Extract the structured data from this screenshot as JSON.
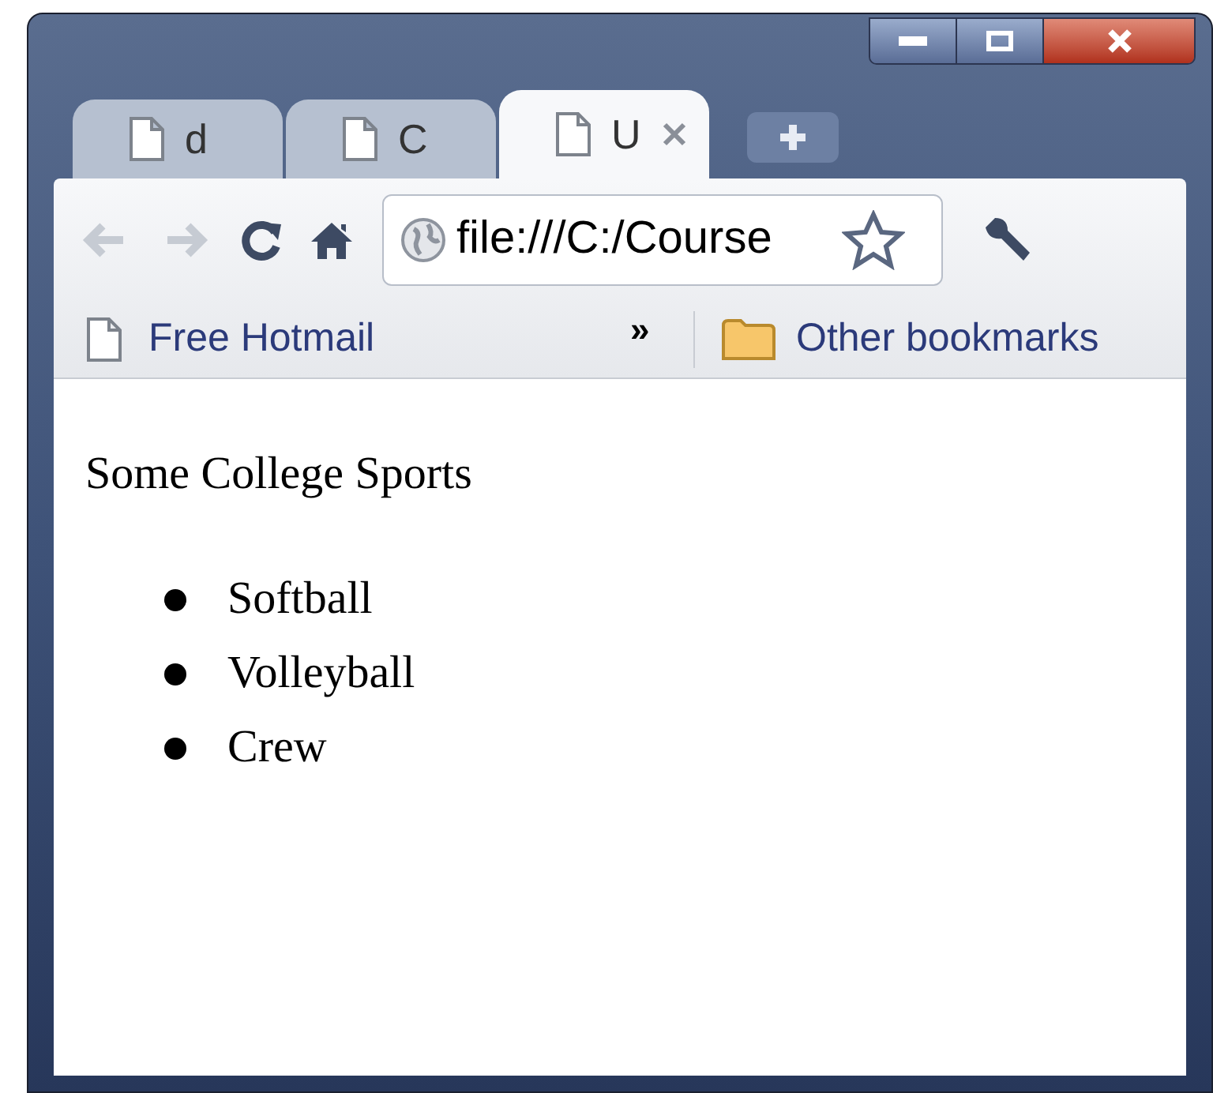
{
  "tabs": [
    {
      "title": "d",
      "selected": false
    },
    {
      "title": "C",
      "selected": false
    },
    {
      "title": "U",
      "selected": true
    }
  ],
  "toolbar": {
    "back": {
      "disabled": true
    },
    "forward": {
      "disabled": true
    },
    "address": "file:///C:/Course"
  },
  "bookmarks": [
    {
      "label": "Free Hotmail",
      "kind": "page"
    }
  ],
  "overflow": "»",
  "other_bookmarks": {
    "label": "Other bookmarks"
  },
  "page": {
    "heading": "Some College Sports",
    "items": [
      "Softball",
      "Volleyball",
      "Crew"
    ]
  }
}
